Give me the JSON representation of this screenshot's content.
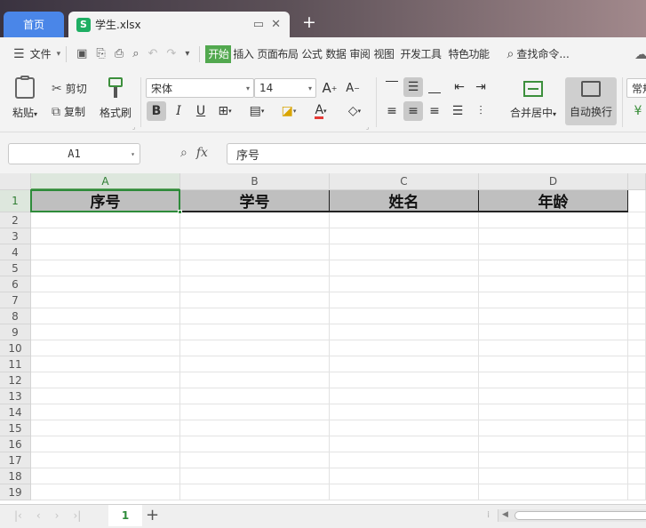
{
  "tabs": {
    "home": "首页",
    "file_icon": "S",
    "file_name": "学生.xlsx"
  },
  "menu": {
    "file": "文件",
    "tabs": [
      "开始",
      "插入",
      "页面布局",
      "公式",
      "数据",
      "审阅",
      "视图",
      "开发工具",
      "特色功能"
    ],
    "active_tab": "开始",
    "search": "查找命令..."
  },
  "ribbon": {
    "paste": "粘贴",
    "cut": "剪切",
    "copy": "复制",
    "format_painter": "格式刷",
    "font_name": "宋体",
    "font_size": "14",
    "bold": "B",
    "italic": "I",
    "underline": "U",
    "merge_center": "合并居中",
    "wrap_text": "自动换行",
    "number_format_partial": "常规"
  },
  "formula_bar": {
    "name_box": "A1",
    "fx": "fx",
    "content": "序号"
  },
  "sheet": {
    "columns": [
      "A",
      "B",
      "C",
      "D"
    ],
    "rows": [
      "1",
      "2",
      "3",
      "4",
      "5",
      "6",
      "7",
      "8",
      "9",
      "10",
      "11",
      "12",
      "13",
      "14",
      "15",
      "16",
      "17",
      "18",
      "19"
    ],
    "header_row": [
      "序号",
      "学号",
      "姓名",
      "年龄"
    ],
    "active_cell": "A1"
  },
  "sheet_tabs": {
    "tabs": [
      "1"
    ],
    "add": "+"
  },
  "colors": {
    "accent": "#52a84f",
    "home_tab": "#4a86e8",
    "header_fill": "#bfbfbf",
    "selection": "#2e8b3a"
  }
}
